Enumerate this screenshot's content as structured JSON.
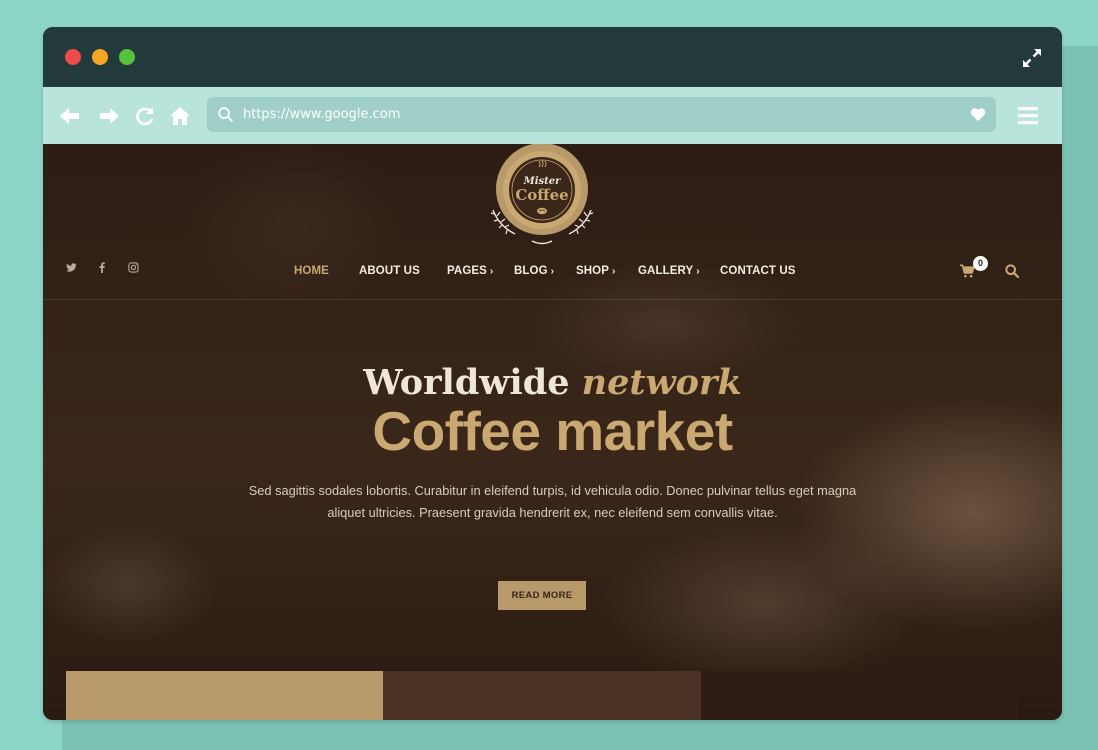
{
  "browser": {
    "url": "https://www.google.com",
    "icons": [
      "back-arrow-icon",
      "forward-arrow-icon",
      "reload-icon",
      "home-icon",
      "search-icon",
      "heart-icon",
      "hamburger-menu-icon",
      "expand-icon"
    ]
  },
  "site": {
    "logo": {
      "line1": "Mister",
      "line2": "Coffee"
    },
    "social": [
      "twitter-icon",
      "facebook-icon",
      "instagram-icon"
    ],
    "nav": [
      {
        "label": "HOME",
        "active": true,
        "has_submenu": false
      },
      {
        "label": "ABOUT US",
        "active": false,
        "has_submenu": false
      },
      {
        "label": "PAGES",
        "active": false,
        "has_submenu": true
      },
      {
        "label": "BLOG",
        "active": false,
        "has_submenu": true
      },
      {
        "label": "SHOP",
        "active": false,
        "has_submenu": true
      },
      {
        "label": "GALLERY",
        "active": false,
        "has_submenu": true
      },
      {
        "label": "CONTACT US",
        "active": false,
        "has_submenu": false
      }
    ],
    "cart_count": "0",
    "hero": {
      "headline_main": "Worldwide ",
      "headline_accent": "network",
      "title": "Coffee market",
      "lead": "Sed sagittis sodales lobortis. Curabitur in eleifend turpis, id vehicula odio. Donec pulvinar tellus eget magna aliquet ultricies. Praesent gravida hendrerit ex, nec eleifend sem convallis vitae.",
      "button": "READ MORE"
    }
  },
  "colors": {
    "accent": "#c9a872",
    "background": "#8dd5c7",
    "titlebar": "#233a3c",
    "toolbar": "#b9e4dc"
  }
}
